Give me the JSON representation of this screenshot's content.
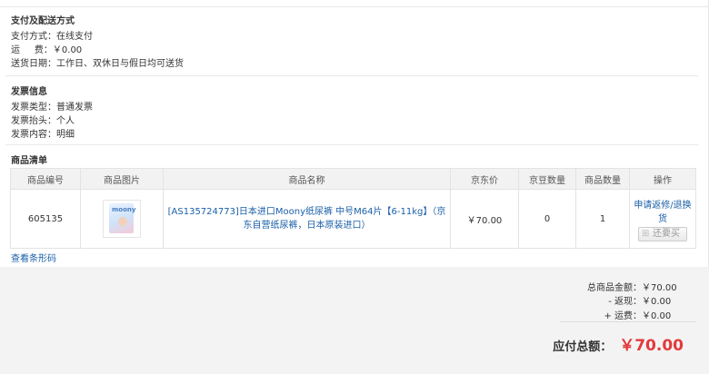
{
  "payment": {
    "title": "支付及配送方式",
    "method_label": "支付方式：",
    "method_value": "在线支付",
    "freight_label": "运     费：",
    "freight_value": "￥0.00",
    "delivery_label": "送货日期：",
    "delivery_value": "工作日、双休日与假日均可送货"
  },
  "invoice": {
    "title": "发票信息",
    "type_label": "发票类型：",
    "type_value": "普通发票",
    "header_label": "发票抬头：",
    "header_value": "个人",
    "content_label": "发票内容：",
    "content_value": "明细"
  },
  "goods": {
    "title": "商品清单",
    "columns": [
      "商品编号",
      "商品图片",
      "商品名称",
      "京东价",
      "京豆数量",
      "商品数量",
      "操作"
    ],
    "rows": [
      {
        "id": "605135",
        "image_logo": "moony",
        "name": "[AS135724773]日本进口Moony纸尿裤 中号M64片【6-11kg】（京东自营纸尿裤，日本原装进口）",
        "price": "￥70.00",
        "beans": "0",
        "quantity": "1",
        "op_link": "申请返修/退换货",
        "op_button": "还要买"
      }
    ],
    "barcode_link": "查看条形码"
  },
  "summary": {
    "total_label": "总商品金额：",
    "total_value": "￥70.00",
    "rebate_label": "- 返现：",
    "rebate_value": "￥0.00",
    "freight_label": "+ 运费：",
    "freight_value": "￥0.00",
    "payable_label": "应付总额：",
    "payable_value": "￥70.00"
  },
  "colors": {
    "link": "#1a5fa8",
    "price_red": "#e4393c",
    "header_bg": "#f2f2f2",
    "summary_bg": "#f3f3f3"
  }
}
